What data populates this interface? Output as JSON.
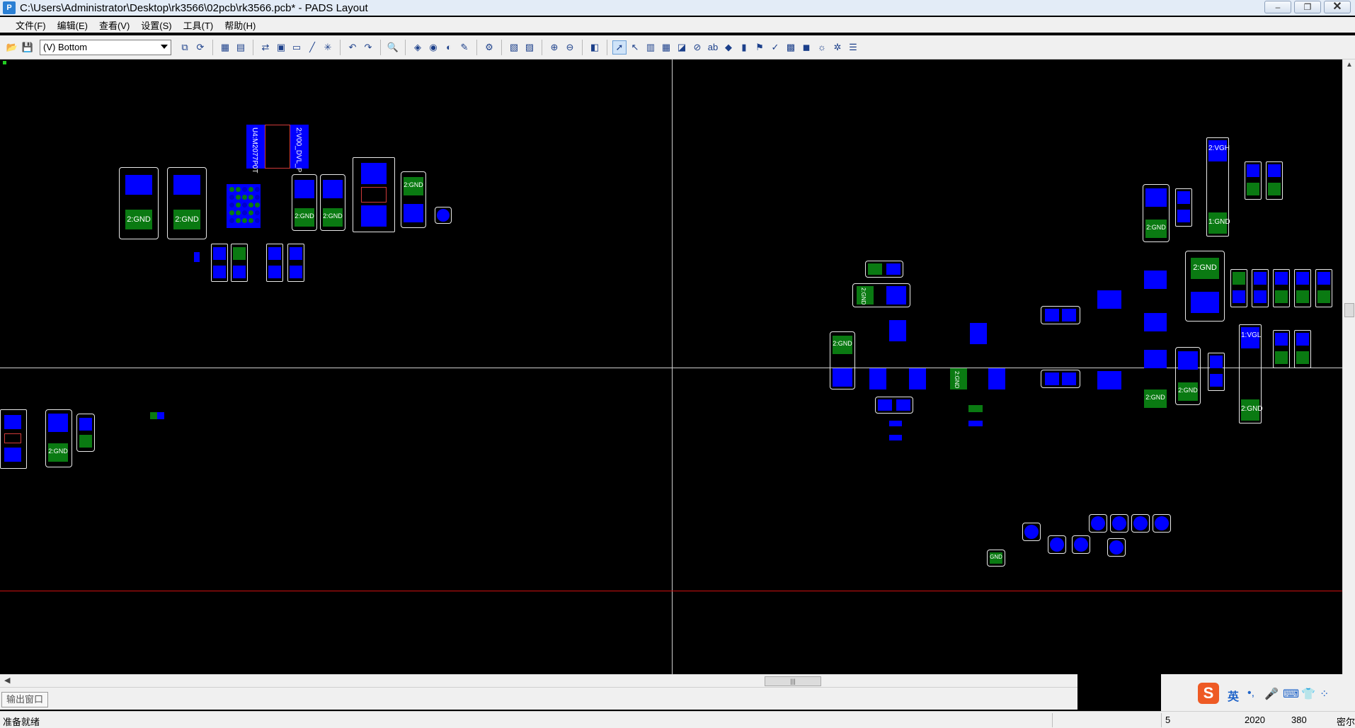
{
  "window": {
    "title": "C:\\Users\\Administrator\\Desktop\\rk3566\\02pcb\\rk3566.pcb* - PADS Layout",
    "app_icon": "pads-app-icon",
    "minimize": "–",
    "maximize": "❐",
    "close": "✕"
  },
  "menu": [
    "文件(F)",
    "编辑(E)",
    "查看(V)",
    "设置(S)",
    "工具(T)",
    "帮助(H)"
  ],
  "toolbar": {
    "layer_value": "(V) Bottom",
    "icons": [
      "open-icon",
      "save-icon",
      "copy-icon",
      "redraw-icon",
      "sketch-icon",
      "route-icon",
      "design-icon",
      "undo-icon",
      "redo-icon",
      "zoom-icon",
      "select-icon"
    ]
  },
  "canvas": {
    "labels": {
      "gnd2": "2:GND",
      "gnd1": "1:GND",
      "vgh": "2:VGH",
      "vgl": "1:VGL",
      "ic_left": "U4:M2077P0T",
      "ic_right": "2:V00_DVL_P",
      "gnd_small": "2:GND",
      "small": "GND"
    }
  },
  "output_tab": "输出窗口",
  "status": {
    "text": "准备就绪",
    "grid": "5",
    "x": "2020",
    "y": "380",
    "unit": "密尔"
  },
  "ime": {
    "lang": "英"
  }
}
